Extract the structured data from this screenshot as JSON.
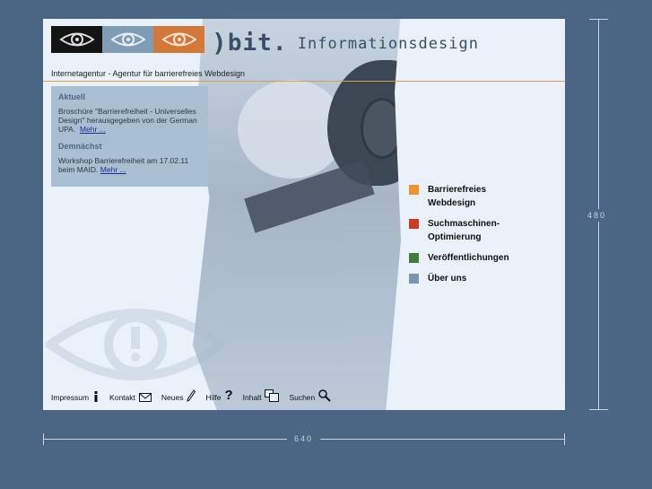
{
  "header": {
    "logo_bracket": ")",
    "logo_bit": "bit.",
    "logo_suffix": "Informationsdesign",
    "tagline": "Internetagentur - Agentur für barrierefreies Webdesign"
  },
  "news": {
    "current_heading": "Aktuell",
    "current_text": "Broschüre \"Barrierefreiheit - Universelles Design\" herausgegeben von der German UPA.",
    "current_link": "Mehr ...",
    "upcoming_heading": "Demnächst",
    "upcoming_text": "Workshop Barrierefreiheit am 17.02.11 beim MAID.",
    "upcoming_link": "Mehr ..."
  },
  "nav": {
    "items": [
      {
        "label": "Barrierefreies Webdesign",
        "color": "#f0922e"
      },
      {
        "label": "Suchmaschinen-Optimierung",
        "color": "#cc3b22"
      },
      {
        "label": "Veröffentlichungen",
        "color": "#3f7d3a"
      },
      {
        "label": "Über uns",
        "color": "#7896b3"
      }
    ]
  },
  "footer": {
    "impressum": "Impressum",
    "kontakt": "Kontakt",
    "neues": "Neues",
    "hilfe": "Hilfe",
    "inhalt": "Inhalt",
    "suchen": "Suchen"
  },
  "dimensions": {
    "width_label": "640",
    "height_label": "480"
  },
  "colors": {
    "background": "#4a6684",
    "page": "#eaf1f8",
    "accent_orange": "#e29a52"
  }
}
